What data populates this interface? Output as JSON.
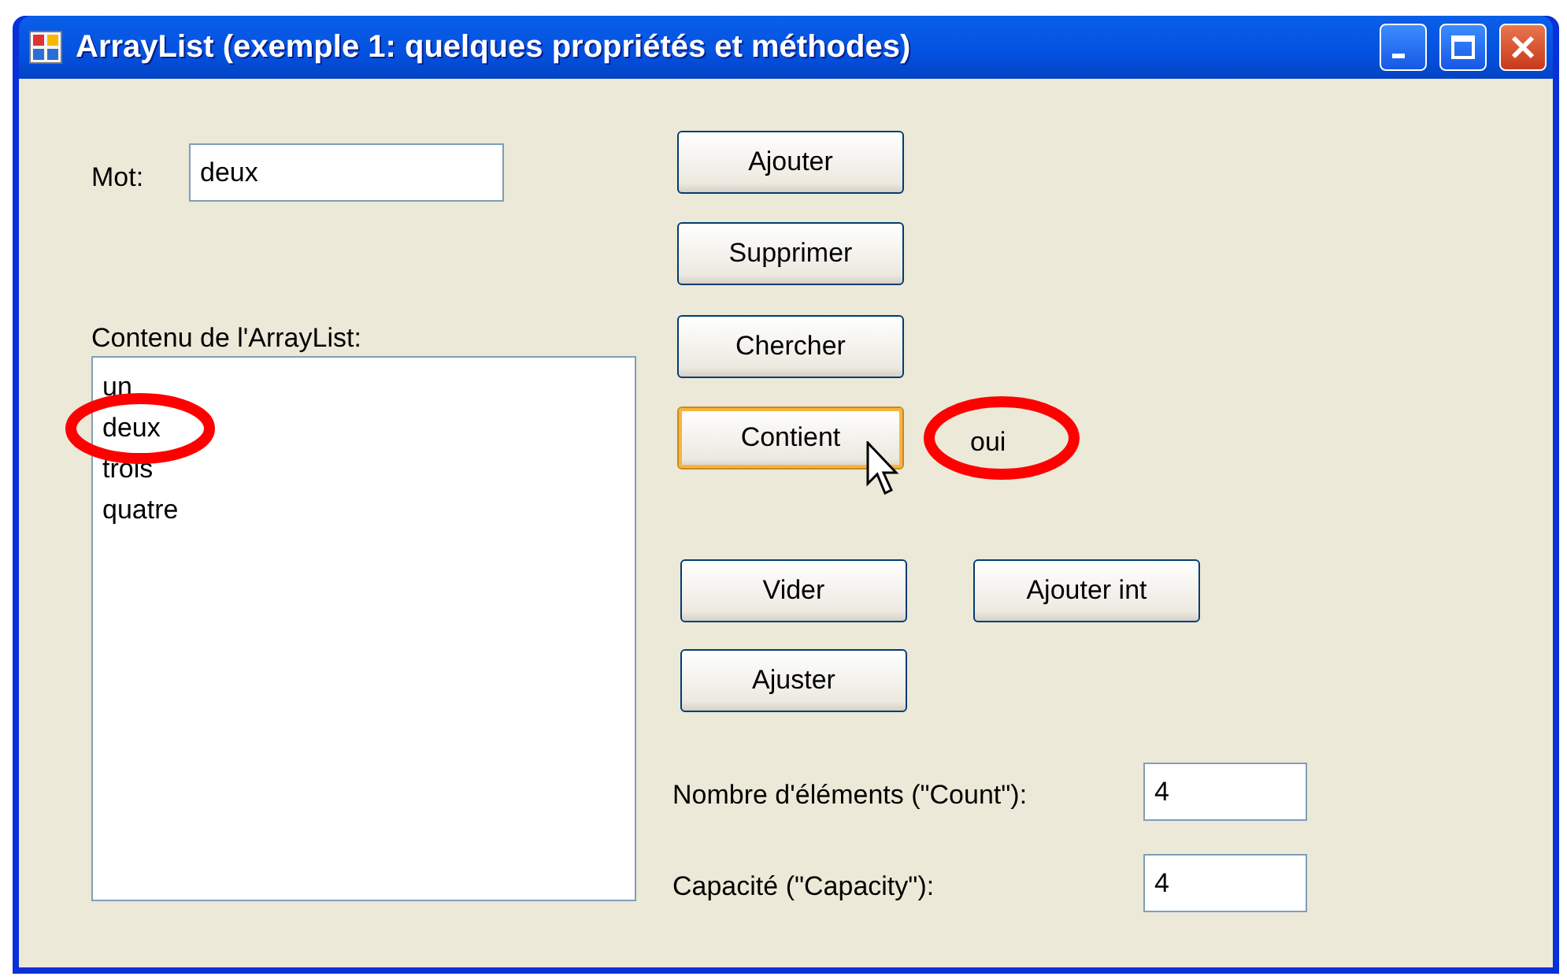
{
  "window": {
    "title": "ArrayList (exemple 1: quelques propriétés et méthodes)"
  },
  "word": {
    "label": "Mot:",
    "value": "deux"
  },
  "list": {
    "label": "Contenu de l'ArrayList:",
    "items": [
      {
        "text": "un",
        "circled": false
      },
      {
        "text": "deux",
        "circled": true
      },
      {
        "text": "trois",
        "circled": false
      },
      {
        "text": "quatre",
        "circled": false
      }
    ]
  },
  "buttons": [
    {
      "label": "Ajouter",
      "hovered": false
    },
    {
      "label": "Supprimer",
      "hovered": false
    },
    {
      "label": "Chercher",
      "hovered": false
    },
    {
      "label": "Contient",
      "hovered": true
    },
    {
      "label": "Vider",
      "hovered": false
    },
    {
      "label": "Ajouter int",
      "hovered": false
    },
    {
      "label": "Ajuster",
      "hovered": false
    }
  ],
  "result": {
    "text": "oui",
    "circled": true
  },
  "fields": [
    {
      "label": "Nombre d'éléments (\"Count\"):",
      "value": "4"
    },
    {
      "label": "Capacité (\"Capacity\"):",
      "value": "4"
    }
  ]
}
